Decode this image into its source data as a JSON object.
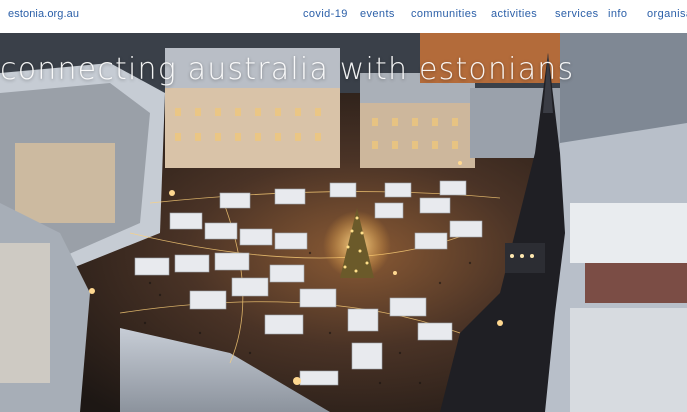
{
  "site": {
    "logo_text": "estonia.org.au"
  },
  "nav": {
    "items": [
      {
        "label": "covid-19"
      },
      {
        "label": "events"
      },
      {
        "label": "communities"
      },
      {
        "label": "activities"
      },
      {
        "label": "services"
      },
      {
        "label": "info"
      },
      {
        "label": "organisa"
      }
    ]
  },
  "hero": {
    "headline": "connecting australia with estonians",
    "image_description_icon": "tallinn-christmas-market-aerial-photo"
  },
  "colors": {
    "link": "#2b5fa8",
    "topbar_bg": "#ffffff",
    "headline": "#ffffff"
  }
}
